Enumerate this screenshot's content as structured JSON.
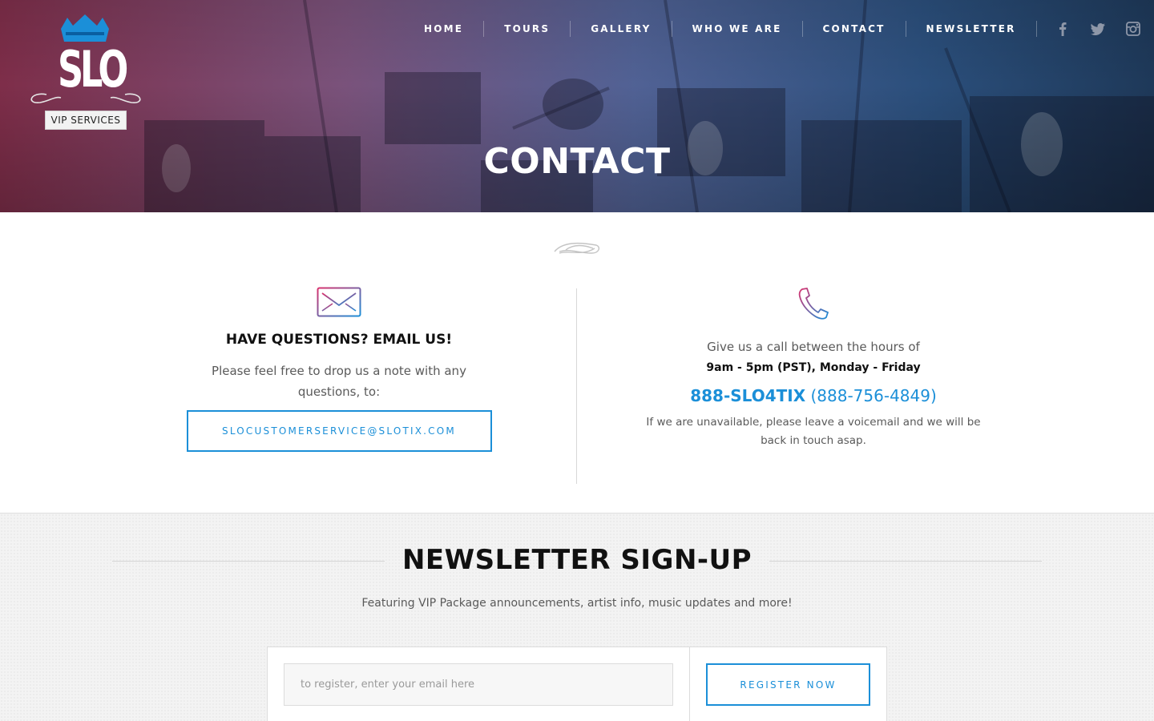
{
  "brand": {
    "logo_text": "SLO",
    "badge": "VIP SERVICES"
  },
  "nav": {
    "items": [
      {
        "label": "HOME"
      },
      {
        "label": "TOURS"
      },
      {
        "label": "GALLERY"
      },
      {
        "label": "WHO WE ARE"
      },
      {
        "label": "CONTACT"
      },
      {
        "label": "NEWSLETTER"
      }
    ],
    "social": [
      "facebook-icon",
      "twitter-icon",
      "instagram-icon"
    ]
  },
  "hero": {
    "title": "CONTACT"
  },
  "email_section": {
    "heading": "HAVE QUESTIONS? EMAIL US!",
    "description": "Please feel free to drop us a note with any questions, to:",
    "email_button": "SLOCUSTOMERSERVICE@SLOTIX.COM"
  },
  "phone_section": {
    "intro": "Give us a call between the hours of",
    "hours": "9am - 5pm (PST), Monday - Friday",
    "phone_name": "888-SLO4TIX",
    "phone_number": "(888-756-4849)",
    "voicemail": "If we are unavailable, please leave a voicemail and we will be back in touch asap."
  },
  "newsletter": {
    "title": "NEWSLETTER SIGN-UP",
    "description": "Featuring VIP Package announcements, artist info, music updates and more!",
    "input_placeholder": "to register, enter your email here",
    "button_label": "REGISTER NOW"
  },
  "colors": {
    "accent": "#1b8fd8",
    "hero_left": "#731c3a",
    "hero_right": "#122e50",
    "mail_icon_gradient": [
      "#d8326e",
      "#1b8fd8"
    ]
  }
}
